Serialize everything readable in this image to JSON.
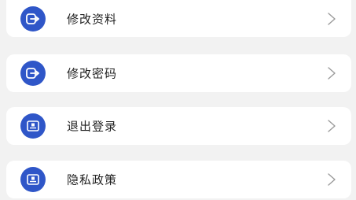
{
  "menu": {
    "items": [
      {
        "label": "修改资料",
        "icon": "logout-arrow-icon"
      },
      {
        "label": "修改密码",
        "icon": "logout-arrow-icon"
      },
      {
        "label": "退出登录",
        "icon": "document-icon"
      },
      {
        "label": "隐私政策",
        "icon": "document-icon"
      }
    ]
  },
  "colors": {
    "background": "#f2f2f2",
    "card": "#ffffff",
    "icon_circle": "#2f56c8",
    "text": "#1f1f1f",
    "chevron": "#9a9a9a"
  }
}
